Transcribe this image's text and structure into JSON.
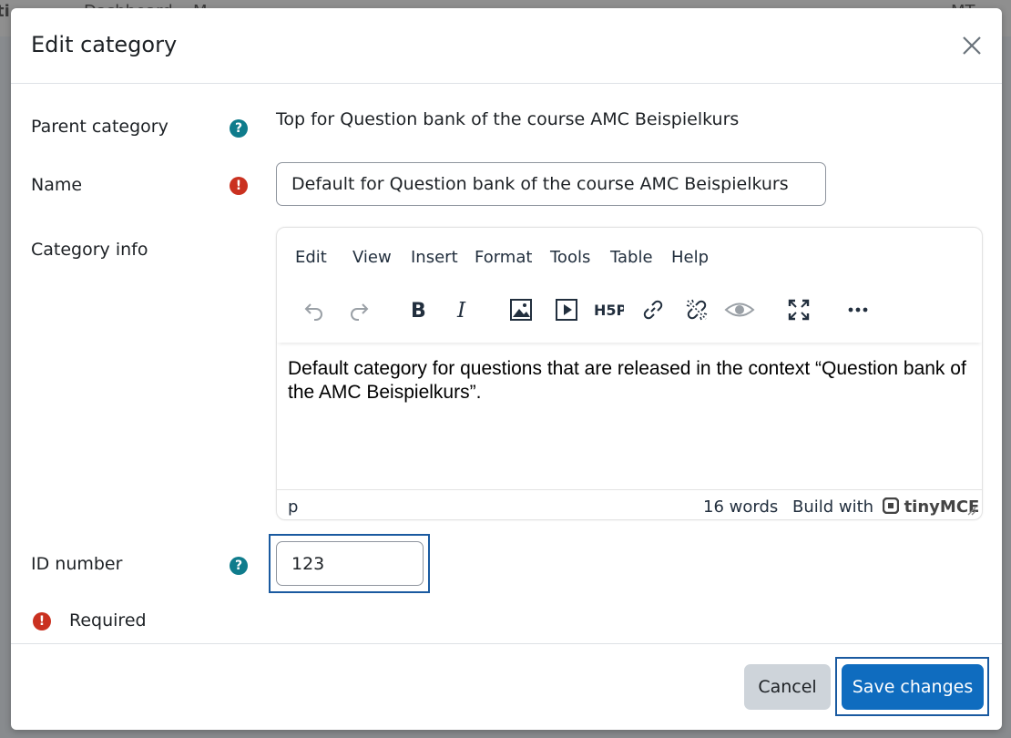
{
  "background": {
    "nav_fragments": [
      "ti",
      "Dashboard",
      "M",
      "MT"
    ]
  },
  "modal": {
    "title": "Edit category",
    "close_label": "×"
  },
  "form": {
    "parent_category": {
      "label": "Parent category",
      "value": "Top for Question bank of the course AMC Beispielkurs"
    },
    "name": {
      "label": "Name",
      "value": "Default for Question bank of the course AMC Beispielkurs"
    },
    "category_info": {
      "label": "Category info"
    },
    "id_number": {
      "label": "ID number",
      "value": "123"
    },
    "required_note": "Required",
    "help_glyph": "?",
    "required_glyph": "!"
  },
  "editor": {
    "menu": [
      "Edit",
      "View",
      "Insert",
      "Format",
      "Tools",
      "Table",
      "Help"
    ],
    "toolbar_icons": [
      "undo-icon",
      "redo-icon",
      "bold-icon",
      "italic-icon",
      "image-icon",
      "media-icon",
      "h5p-icon",
      "link-icon",
      "unlink-icon",
      "preview-icon",
      "fullscreen-icon",
      "more-icon"
    ],
    "content": "Default category for questions that are released in the context “Question bank of the AMC Beispielkurs”.",
    "status_path": "p",
    "word_count": "16 words",
    "brand_prefix": "Build with",
    "brand_name": "tinyMCE"
  },
  "footer": {
    "cancel_label": "Cancel",
    "save_label": "Save changes"
  },
  "colors": {
    "primary": "#0f6cbf",
    "help_icon": "#0f7c8c",
    "required_icon": "#ca3120",
    "focus_ring": "#1a5aa0"
  }
}
